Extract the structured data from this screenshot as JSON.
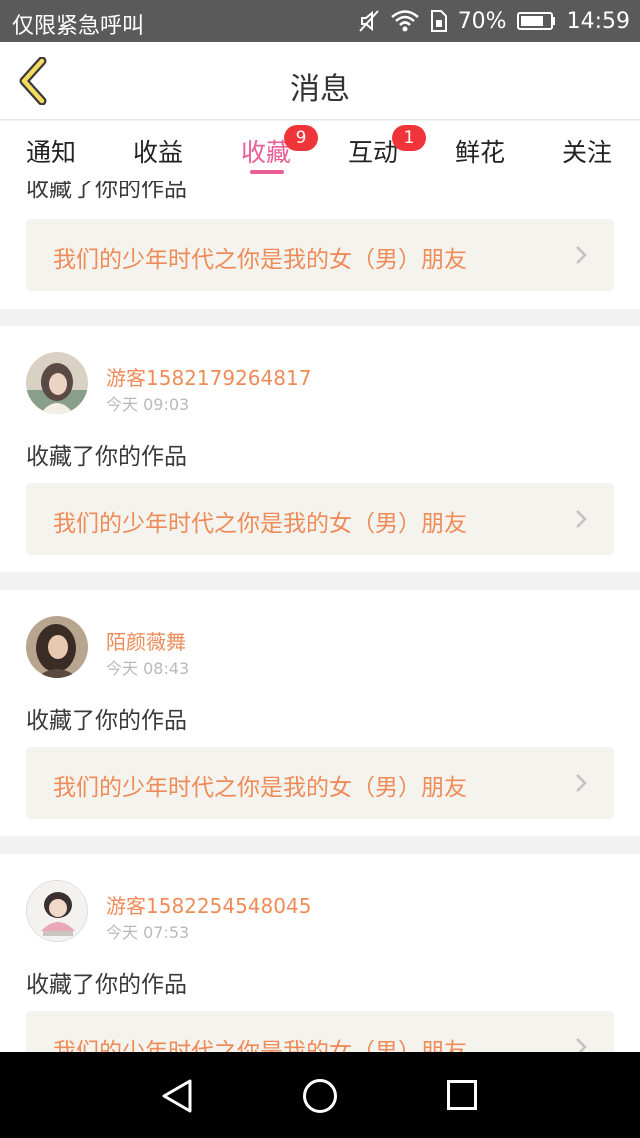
{
  "status_bar": {
    "carrier": "仅限紧急呼叫",
    "battery": "70%",
    "time": "14:59",
    "icons": [
      "mute-icon",
      "wifi-icon",
      "sim-icon",
      "battery-icon"
    ]
  },
  "header": {
    "title": "消息",
    "back_icon": "chevron-left-icon"
  },
  "tabs": [
    {
      "label": "通知"
    },
    {
      "label": "收益"
    },
    {
      "label": "收藏",
      "badge": "9",
      "active": true
    },
    {
      "label": "互动",
      "badge": "1"
    },
    {
      "label": "鲜花"
    },
    {
      "label": "关注"
    }
  ],
  "items": [
    {
      "action": "收藏了你的作品",
      "work_title": "我们的少年时代之你是我的女（男）朋友"
    },
    {
      "name": "游客1582179264817",
      "time": "今天 09:03",
      "action": "收藏了你的作品",
      "work_title": "我们的少年时代之你是我的女（男）朋友"
    },
    {
      "name": "陌颜薇舞",
      "time": "今天 08:43",
      "action": "收藏了你的作品",
      "work_title": "我们的少年时代之你是我的女（男）朋友"
    },
    {
      "name": "游客1582254548045",
      "time": "今天 07:53",
      "action": "收藏了你的作品",
      "work_title": "我们的少年时代之你是我的女（男）朋友"
    }
  ],
  "colors": {
    "accent_pink": "#ea5e95",
    "name_orange": "#ee8c59",
    "badge_red": "#f0353a"
  },
  "nav_bar": {
    "icons": [
      "back-triangle-icon",
      "home-circle-icon",
      "recents-square-icon"
    ]
  }
}
